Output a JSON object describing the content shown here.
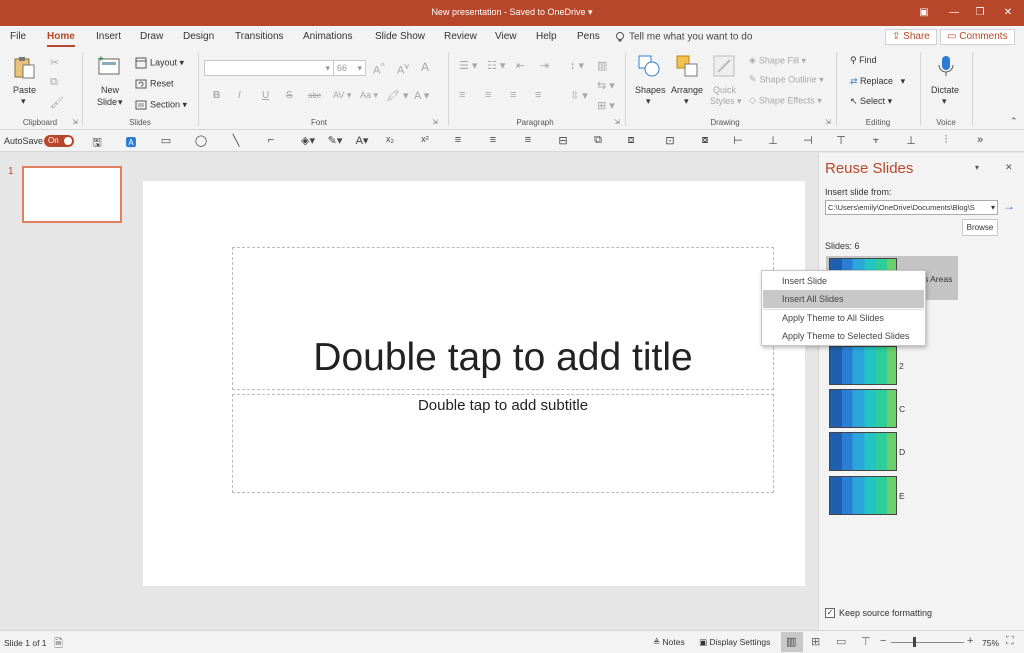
{
  "titlebar": {
    "title": "New presentation  -  Saved to OneDrive",
    "dropdown_glyph": "▾",
    "ribbon_display_glyph": "▣",
    "minimize_glyph": "—",
    "restore_glyph": "❐",
    "close_glyph": "✕",
    "accent": "#b7472a"
  },
  "tabs": [
    "File",
    "Home",
    "Insert",
    "Draw",
    "Design",
    "Transitions",
    "Animations",
    "Slide Show",
    "Review",
    "View",
    "Help",
    "Pens"
  ],
  "active_tab": "Home",
  "tellme": "Tell me what you want to do",
  "share_label": "Share",
  "comments_label": "Comments",
  "ribbon": {
    "clipboard": {
      "label": "Clipboard",
      "paste": "Paste"
    },
    "slides": {
      "label": "Slides",
      "new_slide_1": "New",
      "new_slide_2": "Slide",
      "layout": "Layout",
      "reset": "Reset",
      "section": "Section"
    },
    "font": {
      "label": "Font",
      "font_name": "",
      "font_size": "66",
      "bold": "B",
      "italic": "I",
      "underline": "U",
      "strike": "S",
      "abc": "abc",
      "spacing": "AV",
      "case": "Aa",
      "clear": "A",
      "grow": "A",
      "shrink": "A"
    },
    "paragraph": {
      "label": "Paragraph"
    },
    "drawing": {
      "label": "Drawing",
      "shapes": "Shapes",
      "arrange": "Arrange",
      "quick_styles_1": "Quick",
      "quick_styles_2": "Styles",
      "shape_fill": "Shape Fill",
      "shape_outline": "Shape Outline",
      "shape_effects": "Shape Effects"
    },
    "editing": {
      "label": "Editing",
      "find": "Find",
      "replace": "Replace",
      "select": "Select"
    },
    "voice": {
      "label": "Voice",
      "dictate": "Dictate"
    }
  },
  "qat": {
    "autosave": "AutoSave",
    "toggle": "On",
    "more": "»"
  },
  "thumbnails": [
    {
      "number": "1"
    }
  ],
  "slide": {
    "title_placeholder": "Double tap to add title",
    "subtitle_placeholder": "Double tap to add subtitle"
  },
  "reuse": {
    "title": "Reuse Slides",
    "insert_from_label": "Insert slide from:",
    "path": "C:\\Users\\emily\\OneDrive\\Documents\\Blog\\S",
    "browse": "Browse",
    "slides_count": "Slides: 6",
    "items": [
      {
        "label": "s Areas"
      },
      {
        "label": "2"
      },
      {
        "label": "C"
      },
      {
        "label": "D"
      },
      {
        "label": "E"
      }
    ],
    "keep_formatting": "Keep source formatting",
    "pin_glyph": "▾",
    "close_glyph": "✕",
    "go_glyph": "→"
  },
  "context_menu": {
    "items": [
      "Insert Slide",
      "Insert All Slides",
      "Apply Theme to All Slides",
      "Apply Theme to Selected Slides"
    ],
    "highlighted": "Insert All Slides"
  },
  "status": {
    "slide_info": "Slide 1 of 1",
    "notes": "Notes",
    "display_settings": "Display Settings",
    "zoom": "75%",
    "zoom_minus": "−",
    "zoom_plus": "+",
    "zoom_fraction": 0.3
  }
}
